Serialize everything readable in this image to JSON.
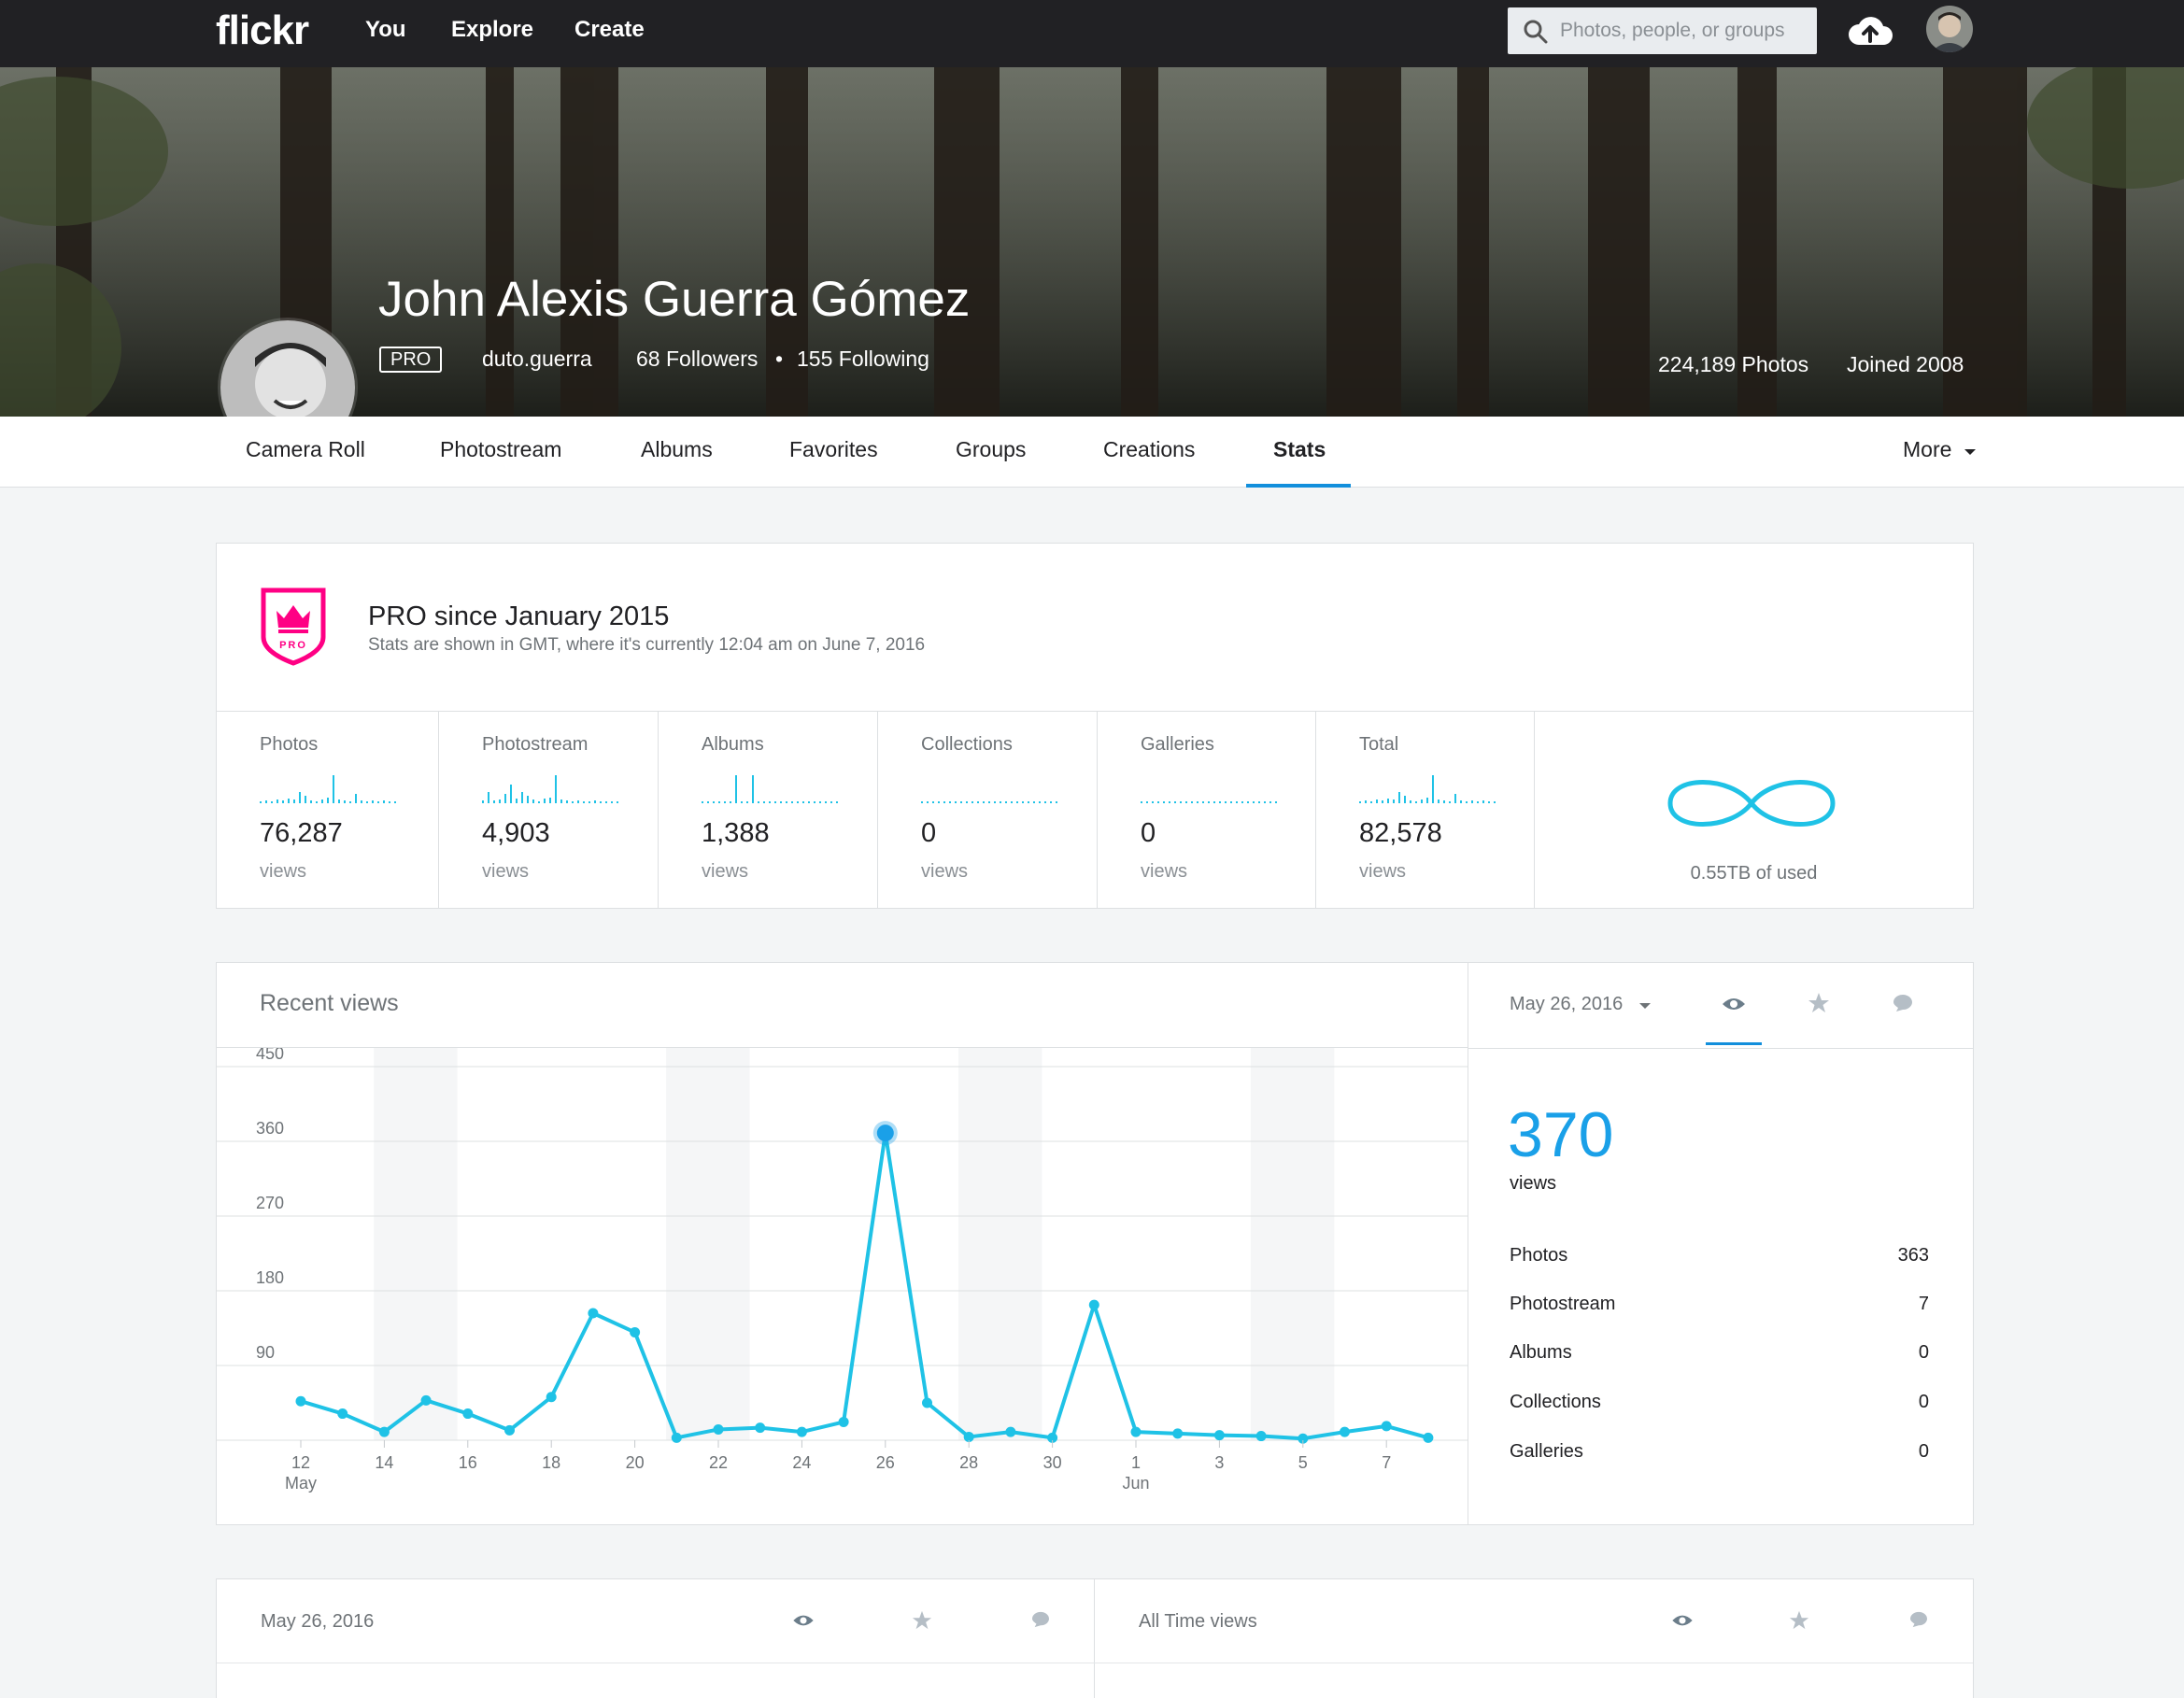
{
  "nav": {
    "logo": "flickr",
    "links": [
      "You",
      "Explore",
      "Create"
    ],
    "search_placeholder": "Photos, people, or groups"
  },
  "profile": {
    "name": "John Alexis Guerra Gómez",
    "badge": "PRO",
    "username": "duto.guerra",
    "followers": "68 Followers",
    "separator": "•",
    "following": "155 Following",
    "photos": "224,189 Photos",
    "joined": "Joined 2008"
  },
  "tabs": [
    "Camera Roll",
    "Photostream",
    "Albums",
    "Favorites",
    "Groups",
    "Creations",
    "Stats"
  ],
  "more_label": "More",
  "pro_card": {
    "title": "PRO since January 2015",
    "subtitle": "Stats are shown in GMT, where it's currently 12:04 am on June 7, 2016",
    "badge_text": "PRO"
  },
  "stats": [
    {
      "label": "Photos",
      "value": "76,287",
      "unit": "views"
    },
    {
      "label": "Photostream",
      "value": "4,903",
      "unit": "views"
    },
    {
      "label": "Albums",
      "value": "1,388",
      "unit": "views"
    },
    {
      "label": "Collections",
      "value": "0",
      "unit": "views"
    },
    {
      "label": "Galleries",
      "value": "0",
      "unit": "views"
    },
    {
      "label": "Total",
      "value": "82,578",
      "unit": "views"
    }
  ],
  "storage": "0.55TB of used",
  "recent_views": {
    "title": "Recent views",
    "selected_date": "May 26, 2016",
    "total": "370",
    "total_unit": "views",
    "breakdown": [
      {
        "label": "Photos",
        "value": "363"
      },
      {
        "label": "Photostream",
        "value": "7"
      },
      {
        "label": "Albums",
        "value": "0"
      },
      {
        "label": "Collections",
        "value": "0"
      },
      {
        "label": "Galleries",
        "value": "0"
      }
    ]
  },
  "chart_data": {
    "type": "line",
    "title": "Recent views",
    "x": [
      "May 12",
      "May 13",
      "May 14",
      "May 15",
      "May 16",
      "May 17",
      "May 18",
      "May 19",
      "May 20",
      "May 21",
      "May 22",
      "May 23",
      "May 24",
      "May 25",
      "May 26",
      "May 27",
      "May 28",
      "May 29",
      "May 30",
      "May 31",
      "Jun 1",
      "Jun 2",
      "Jun 3",
      "Jun 4",
      "Jun 5",
      "Jun 6",
      "Jun 7",
      "Jun 8"
    ],
    "values": [
      47,
      32,
      10,
      48,
      32,
      12,
      52,
      153,
      130,
      3,
      13,
      15,
      10,
      22,
      370,
      45,
      4,
      10,
      3,
      163,
      10,
      8,
      6,
      5,
      2,
      10,
      17,
      3
    ],
    "xticks": [
      {
        "label": "12",
        "sub": "May",
        "i": 0
      },
      {
        "label": "14",
        "sub": "",
        "i": 2
      },
      {
        "label": "16",
        "sub": "",
        "i": 4
      },
      {
        "label": "18",
        "sub": "",
        "i": 6
      },
      {
        "label": "20",
        "sub": "",
        "i": 8
      },
      {
        "label": "22",
        "sub": "",
        "i": 10
      },
      {
        "label": "24",
        "sub": "",
        "i": 12
      },
      {
        "label": "26",
        "sub": "",
        "i": 14
      },
      {
        "label": "28",
        "sub": "",
        "i": 16
      },
      {
        "label": "30",
        "sub": "",
        "i": 18
      },
      {
        "label": "1",
        "sub": "Jun",
        "i": 20
      },
      {
        "label": "3",
        "sub": "",
        "i": 22
      },
      {
        "label": "5",
        "sub": "",
        "i": 24
      },
      {
        "label": "7",
        "sub": "",
        "i": 26
      }
    ],
    "yticks": [
      90,
      180,
      270,
      360,
      450
    ],
    "ylim": [
      0,
      450
    ],
    "highlight_index": 14,
    "shaded_weekends": [
      [
        1.75,
        2.75
      ],
      [
        8.75,
        9.75
      ],
      [
        15.75,
        16.75
      ],
      [
        22.75,
        23.75
      ]
    ],
    "line_color": "#1fc2e6",
    "highlight_color": "#1aa0e8"
  },
  "bottom": {
    "left_title": "May 26, 2016",
    "right_title": "All Time views"
  },
  "colors": {
    "accent": "#128fdc",
    "spark": "#1fc2e6",
    "pro_pink": "#ff0084"
  }
}
